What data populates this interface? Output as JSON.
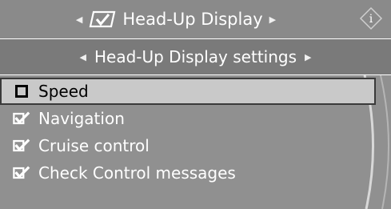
{
  "header": {
    "title": "Head-Up Display",
    "left_arrow_icon": "arrow-left-small",
    "right_arrow_icon": "arrow-right-small",
    "hud_icon": "hud-icon",
    "info_icon": "info-icon"
  },
  "subheader": {
    "title": "Head-Up Display settings"
  },
  "items": [
    {
      "label": "Speed",
      "checked": false,
      "selected": true
    },
    {
      "label": "Navigation",
      "checked": true,
      "selected": false
    },
    {
      "label": "Cruise control",
      "checked": true,
      "selected": false
    },
    {
      "label": "Check Control messages",
      "checked": true,
      "selected": false
    }
  ],
  "colors": {
    "header_bg": "#8a8a8a",
    "subheader_bg": "#7a7a7a",
    "list_bg": "#909090",
    "selected_bg": "#c9c9c9",
    "text": "#ffffff"
  }
}
